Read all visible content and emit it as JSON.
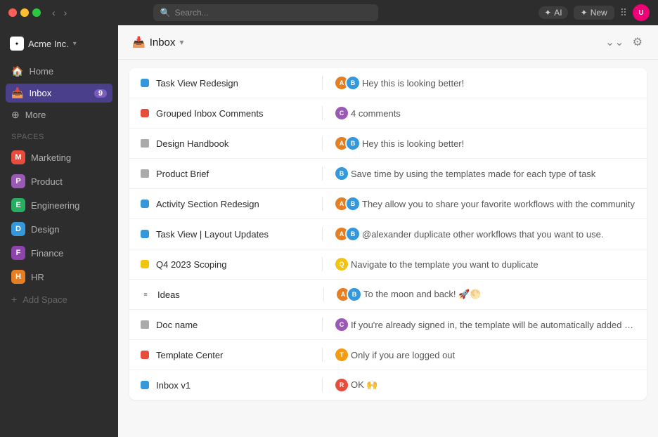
{
  "titlebar": {
    "dots": [
      "red",
      "yellow",
      "green"
    ],
    "search_placeholder": "Search...",
    "ai_label": "AI",
    "new_label": "New"
  },
  "sidebar": {
    "workspace_name": "Acme Inc.",
    "nav_items": [
      {
        "id": "home",
        "label": "Home",
        "icon": "🏠",
        "active": false
      },
      {
        "id": "inbox",
        "label": "Inbox",
        "icon": "📥",
        "active": true,
        "badge": "9"
      },
      {
        "id": "more",
        "label": "More",
        "icon": "⊕",
        "active": false
      }
    ],
    "spaces_label": "Spaces",
    "spaces": [
      {
        "id": "marketing",
        "label": "Marketing",
        "color": "#e74c3c",
        "letter": "M"
      },
      {
        "id": "product",
        "label": "Product",
        "color": "#9b59b6",
        "letter": "P"
      },
      {
        "id": "engineering",
        "label": "Engineering",
        "color": "#27ae60",
        "letter": "E"
      },
      {
        "id": "design",
        "label": "Design",
        "color": "#3498db",
        "letter": "D"
      },
      {
        "id": "finance",
        "label": "Finance",
        "color": "#8e44ad",
        "letter": "F"
      },
      {
        "id": "hr",
        "label": "HR",
        "color": "#e67e22",
        "letter": "H"
      }
    ],
    "add_space_label": "Add Space"
  },
  "content": {
    "header": {
      "title": "Inbox",
      "title_icon": "📥"
    },
    "inbox_rows": [
      {
        "id": "task-view-redesign",
        "indicator_color": "#3498db",
        "indicator_shape": "square",
        "name": "Task View Redesign",
        "avatars": [
          "#e67e22",
          "#3498db"
        ],
        "comment": "Hey this is looking better!"
      },
      {
        "id": "grouped-inbox-comments",
        "indicator_color": "#e74c3c",
        "indicator_shape": "square",
        "name": "Grouped Inbox Comments",
        "avatars": [
          "#9b59b6"
        ],
        "comment": "4 comments",
        "is_count": true
      },
      {
        "id": "design-handbook",
        "indicator_color": "#aaa",
        "indicator_shape": "doc",
        "name": "Design Handbook",
        "avatars": [
          "#e67e22",
          "#3498db"
        ],
        "comment": "Hey this is looking better!"
      },
      {
        "id": "product-brief",
        "indicator_color": "#aaa",
        "indicator_shape": "doc",
        "name": "Product Brief",
        "avatars": [
          "#3498db"
        ],
        "comment": "Save time by using the templates made for each type of task"
      },
      {
        "id": "activity-section-redesign",
        "indicator_color": "#3498db",
        "indicator_shape": "square",
        "name": "Activity Section Redesign",
        "avatars": [
          "#e67e22",
          "#3498db"
        ],
        "comment": "They allow you to share your favorite workflows with the community"
      },
      {
        "id": "task-view-layout",
        "indicator_color": "#3498db",
        "indicator_shape": "square",
        "name": "Task View | Layout Updates",
        "avatars": [
          "#e67e22",
          "#3498db"
        ],
        "comment": "@alexander duplicate other workflows that you want to use."
      },
      {
        "id": "q4-2023-scoping",
        "indicator_color": "#f1c40f",
        "indicator_shape": "square",
        "name": "Q4 2023 Scoping",
        "avatars": [
          "#f1c40f"
        ],
        "comment": "Navigate to the template you want to duplicate"
      },
      {
        "id": "ideas",
        "indicator_color": "#aaa",
        "indicator_shape": "list",
        "name": "Ideas",
        "avatars": [
          "#e67e22",
          "#3498db"
        ],
        "comment": "To the moon and back! 🚀🌕"
      },
      {
        "id": "doc-name",
        "indicator_color": "#aaa",
        "indicator_shape": "doc",
        "name": "Doc name",
        "avatars": [
          "#9b59b6"
        ],
        "comment": "If you're already signed in, the template will be automatically added to your..."
      },
      {
        "id": "template-center",
        "indicator_color": "#e74c3c",
        "indicator_shape": "square",
        "name": "Template Center",
        "avatars": [
          "#f39c12"
        ],
        "comment": "Only if you are logged out"
      },
      {
        "id": "inbox-v1",
        "indicator_color": "#3498db",
        "indicator_shape": "square",
        "name": "Inbox v1",
        "avatars": [
          "#e74c3c"
        ],
        "comment": "OK 🙌"
      }
    ]
  }
}
